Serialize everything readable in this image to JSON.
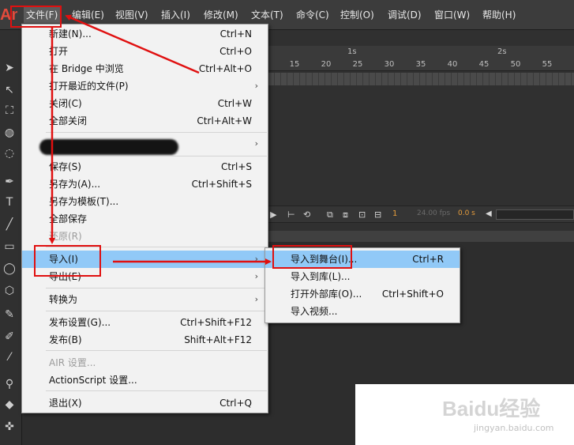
{
  "app_logo": "An",
  "menubar": {
    "items": [
      {
        "label": "文件(F)"
      },
      {
        "label": "编辑(E)"
      },
      {
        "label": "视图(V)"
      },
      {
        "label": "插入(I)"
      },
      {
        "label": "修改(M)"
      },
      {
        "label": "文本(T)"
      },
      {
        "label": "命令(C)"
      },
      {
        "label": "控制(O)"
      },
      {
        "label": "调试(D)"
      },
      {
        "label": "窗口(W)"
      },
      {
        "label": "帮助(H)"
      }
    ]
  },
  "file_menu": {
    "items": [
      {
        "label": "新建(N)...",
        "shortcut": "Ctrl+N"
      },
      {
        "label": "打开",
        "shortcut": "Ctrl+O"
      },
      {
        "label": "在 Bridge 中浏览",
        "shortcut": "Ctrl+Alt+O"
      },
      {
        "label": "打开最近的文件(P)",
        "arrow": "›"
      },
      {
        "label": "关闭(C)",
        "shortcut": "Ctrl+W"
      },
      {
        "label": "全部关闭",
        "shortcut": "Ctrl+Alt+W"
      },
      {
        "label": "",
        "arrow": "›"
      },
      {
        "label": "保存(S)",
        "shortcut": "Ctrl+S"
      },
      {
        "label": "另存为(A)...",
        "shortcut": "Ctrl+Shift+S"
      },
      {
        "label": "另存为模板(T)..."
      },
      {
        "label": "全部保存"
      },
      {
        "label": "还原(R)"
      },
      {
        "label": "导入(I)",
        "arrow": "›"
      },
      {
        "label": "导出(E)",
        "arrow": "›"
      },
      {
        "label": "转换为",
        "arrow": "›"
      },
      {
        "label": "发布设置(G)...",
        "shortcut": "Ctrl+Shift+F12"
      },
      {
        "label": "发布(B)",
        "shortcut": "Shift+Alt+F12"
      },
      {
        "label": "AIR 设置..."
      },
      {
        "label": "ActionScript 设置..."
      },
      {
        "label": "退出(X)",
        "shortcut": "Ctrl+Q"
      }
    ]
  },
  "import_submenu": {
    "items": [
      {
        "label": "导入到舞台(I)...",
        "shortcut": "Ctrl+R"
      },
      {
        "label": "导入到库(L)..."
      },
      {
        "label": "打开外部库(O)...",
        "shortcut": "Ctrl+Shift+O"
      },
      {
        "label": "导入视频..."
      }
    ]
  },
  "timeline": {
    "second_labels": [
      "1s",
      "2s"
    ],
    "frame_labels": [
      "15",
      "20",
      "25",
      "30",
      "35",
      "40",
      "45",
      "50",
      "55"
    ],
    "current_frame": "1",
    "fps": "24.00 fps",
    "time": "0.0 s"
  },
  "watermark": {
    "main": "Baidu经验",
    "sub": "jingyan.baidu.com"
  },
  "colors": {
    "menu_highlight": "#91c9f7",
    "annotation_red": "#e01010",
    "logo_red": "#e34b3c"
  }
}
